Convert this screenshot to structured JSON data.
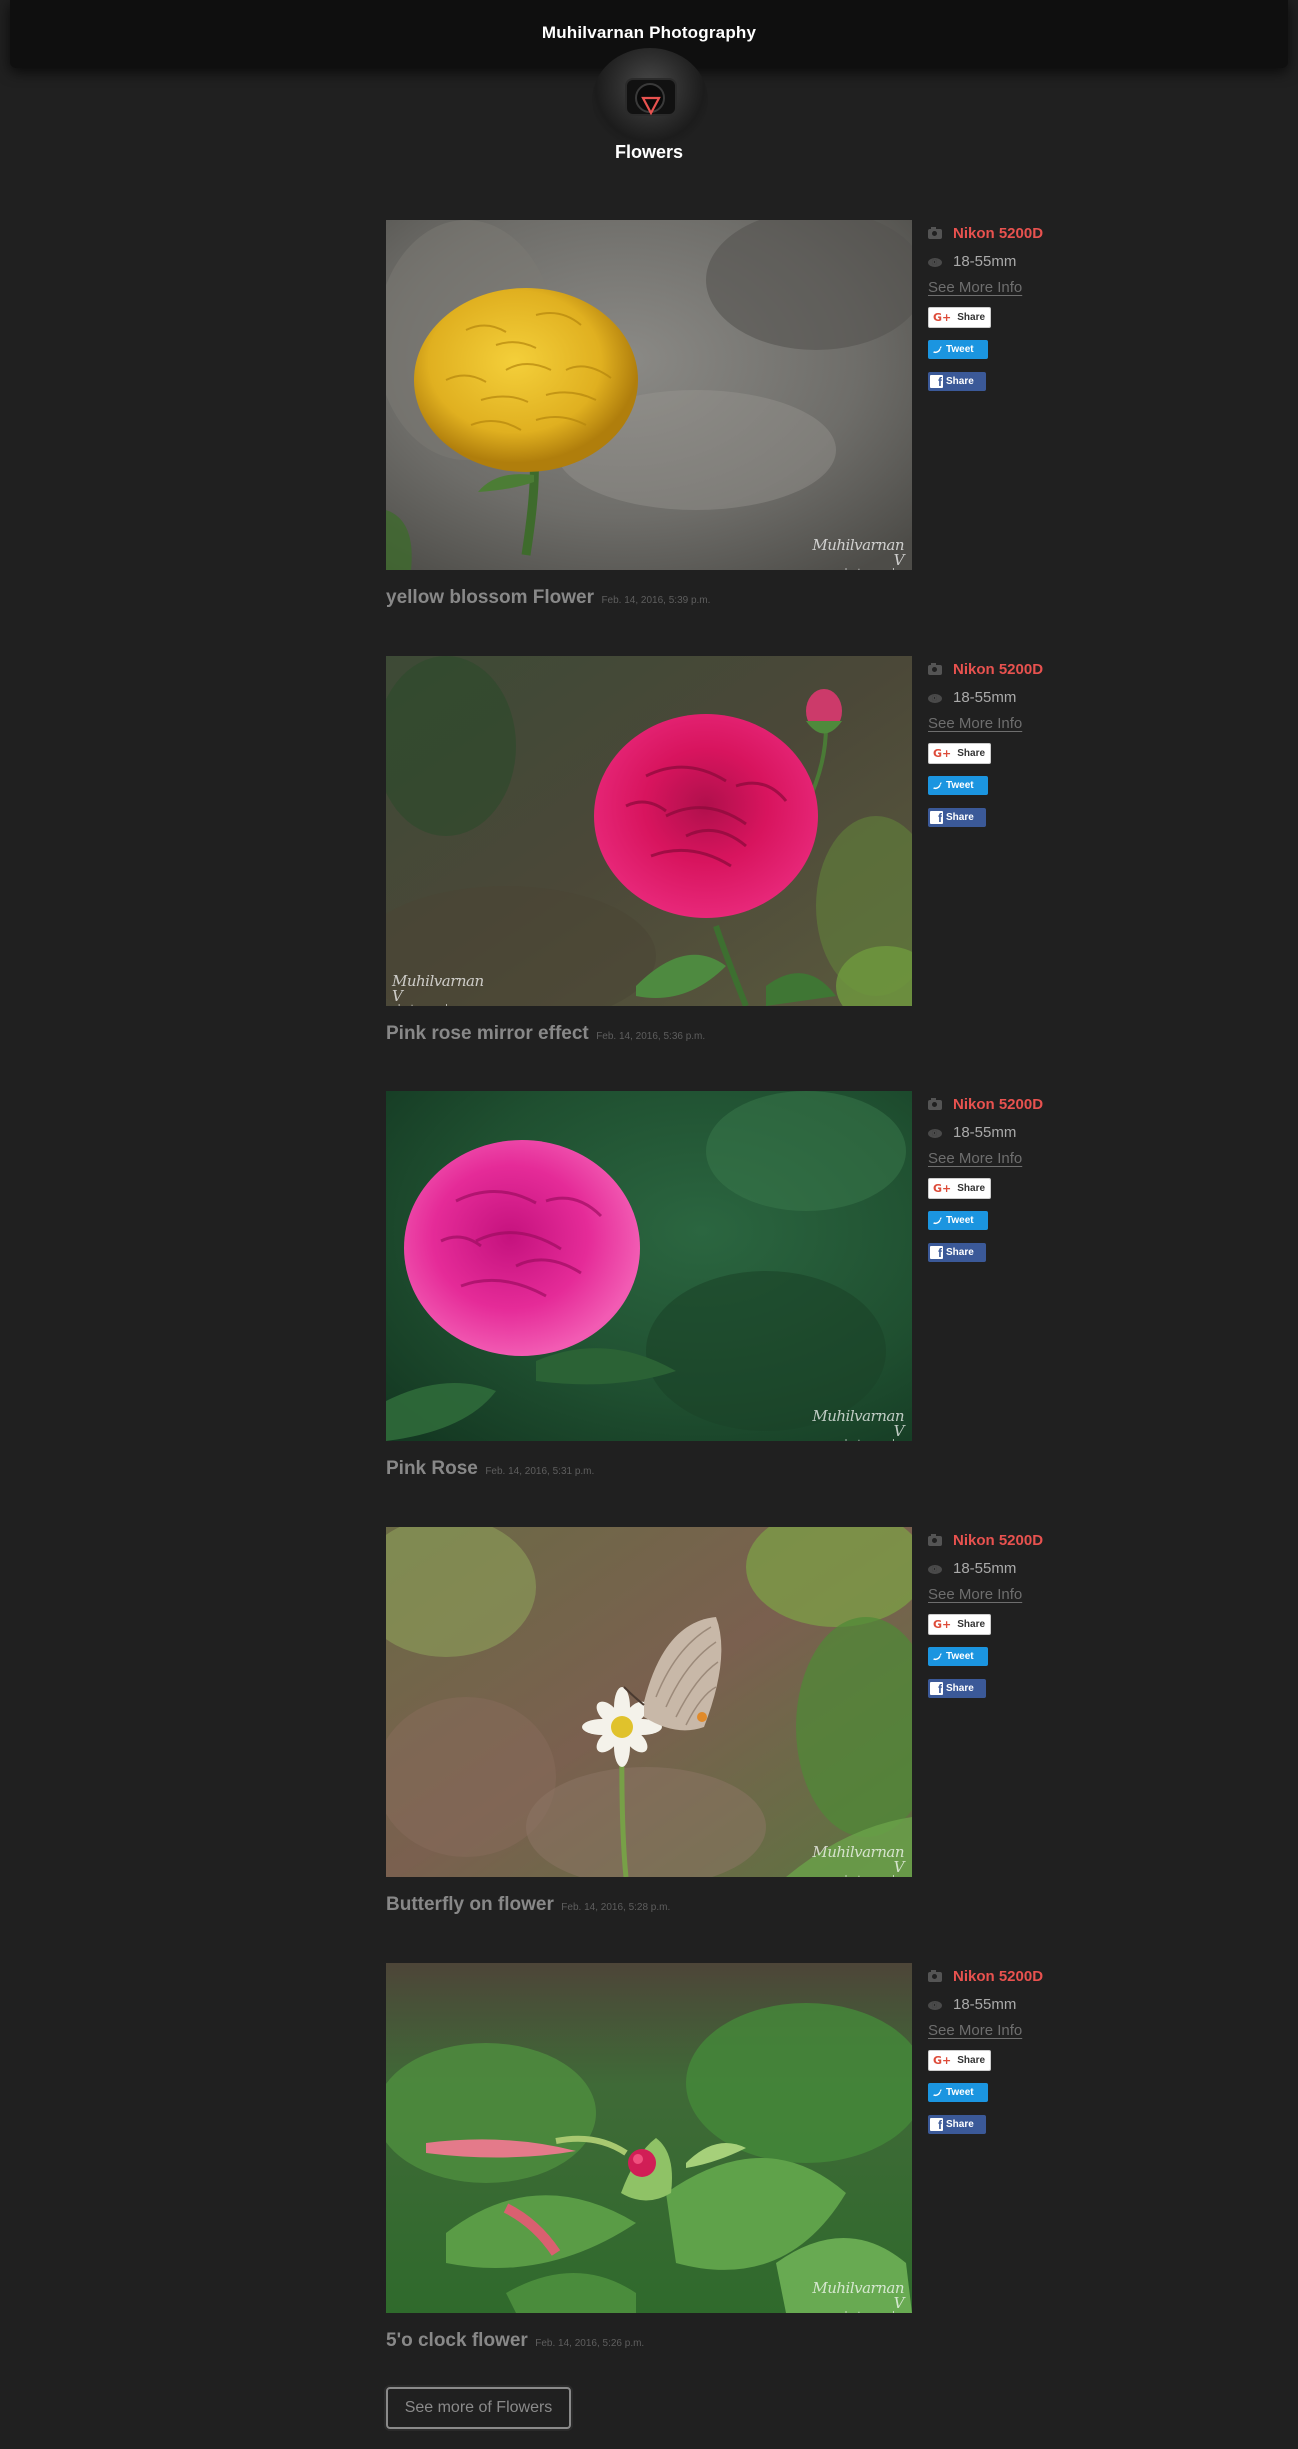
{
  "site": {
    "title": "Muhilvarnan Photography"
  },
  "category": {
    "title": "Flowers"
  },
  "posts": [
    {
      "title": "yellow blossom Flower",
      "date": "Feb. 14, 2016, 5:39 p.m.",
      "camera": "Nikon 5200D",
      "lens": "18-55mm",
      "more_info": "See More Info",
      "gplus_label": "Share",
      "tweet_label": "Tweet",
      "fb_label": "Share",
      "watermark": "Muhilvarnan V",
      "watermark_sub": "photography"
    },
    {
      "title": "Pink rose mirror effect",
      "date": "Feb. 14, 2016, 5:36 p.m.",
      "camera": "Nikon 5200D",
      "lens": "18-55mm",
      "more_info": "See More Info",
      "gplus_label": "Share",
      "tweet_label": "Tweet",
      "fb_label": "Share",
      "watermark": "Muhilvarnan V",
      "watermark_sub": "photography"
    },
    {
      "title": "Pink Rose",
      "date": "Feb. 14, 2016, 5:31 p.m.",
      "camera": "Nikon 5200D",
      "lens": "18-55mm",
      "more_info": "See More Info",
      "gplus_label": "Share",
      "tweet_label": "Tweet",
      "fb_label": "Share",
      "watermark": "Muhilvarnan V",
      "watermark_sub": "photography"
    },
    {
      "title": "Butterfly on flower",
      "date": "Feb. 14, 2016, 5:28 p.m.",
      "camera": "Nikon 5200D",
      "lens": "18-55mm",
      "more_info": "See More Info",
      "gplus_label": "Share",
      "tweet_label": "Tweet",
      "fb_label": "Share",
      "watermark": "Muhilvarnan V",
      "watermark_sub": "photography"
    },
    {
      "title": "5'o clock flower",
      "date": "Feb. 14, 2016, 5:26 p.m.",
      "camera": "Nikon 5200D",
      "lens": "18-55mm",
      "more_info": "See More Info",
      "gplus_label": "Share",
      "tweet_label": "Tweet",
      "fb_label": "Share",
      "watermark": "Muhilvarnan V",
      "watermark_sub": "photography"
    }
  ],
  "see_more": "See more of Flowers"
}
